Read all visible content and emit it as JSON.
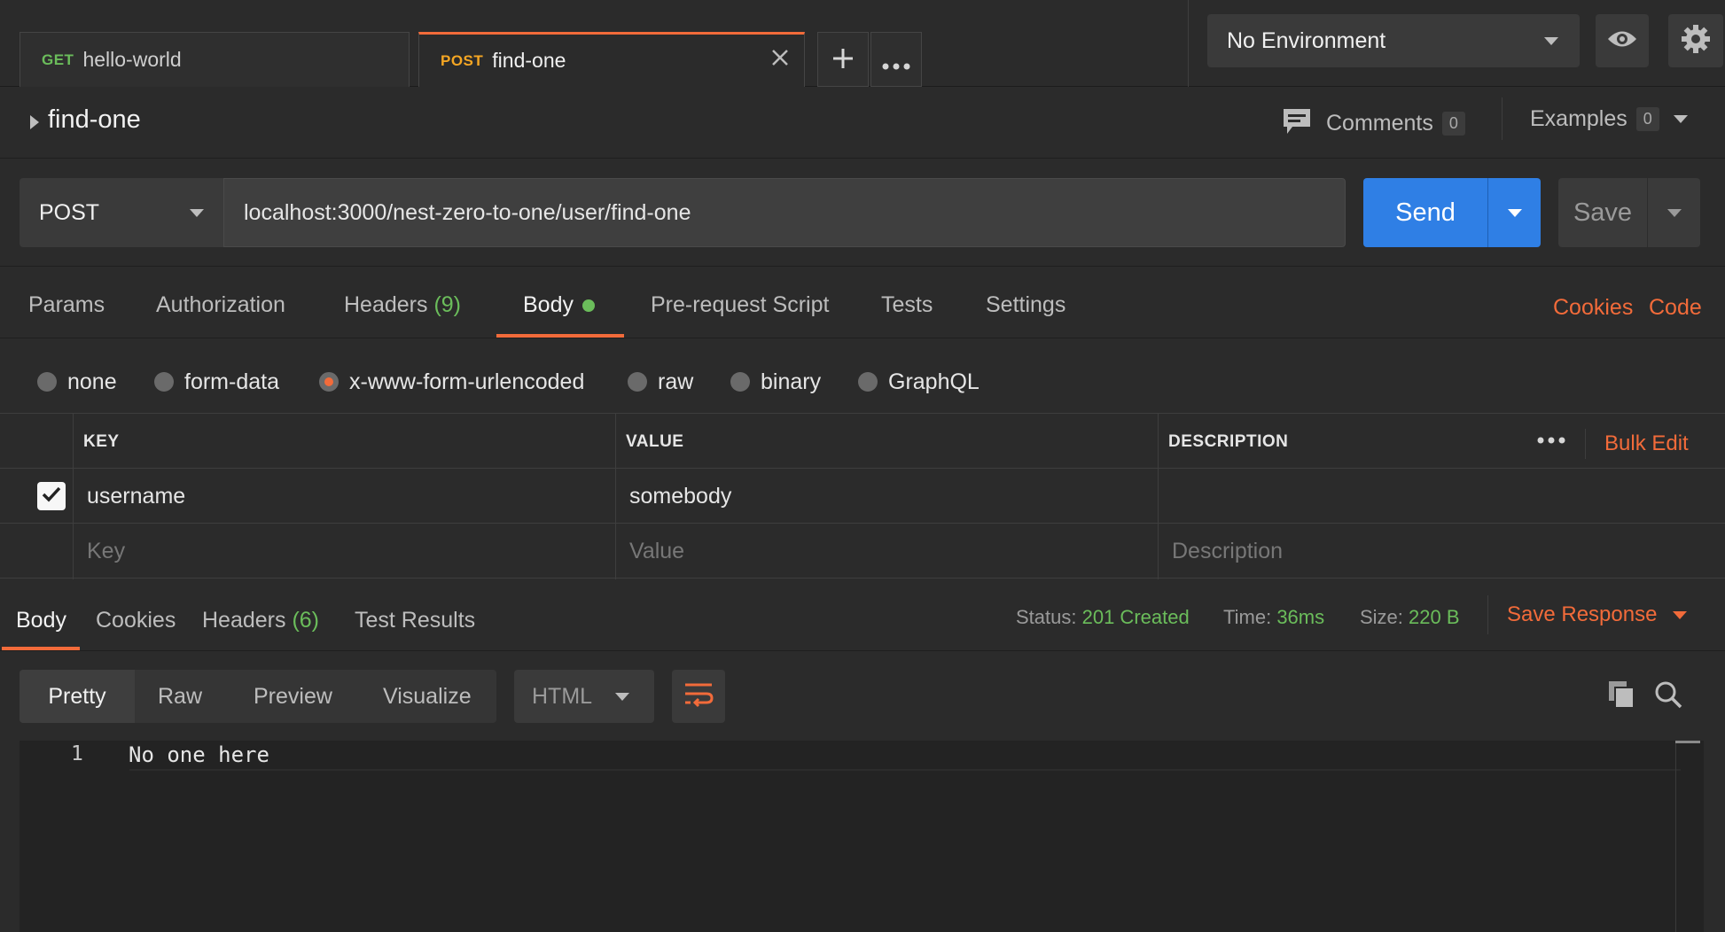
{
  "tabs": [
    {
      "method": "GET",
      "name": "hello-world"
    },
    {
      "method": "POST",
      "name": "find-one"
    }
  ],
  "tab_actions": {
    "add_icon": "plus-icon",
    "more_icon": "more-icon",
    "close_icon": "close-icon"
  },
  "environment": {
    "selected": "No Environment",
    "eye_icon": "eye-icon",
    "settings_icon": "gear-icon"
  },
  "request": {
    "title": "find-one",
    "comments_label": "Comments",
    "comments_count": "0",
    "examples_label": "Examples",
    "examples_count": "0",
    "method": "POST",
    "url": "localhost:3000/nest-zero-to-one/user/find-one",
    "send_label": "Send",
    "save_label": "Save"
  },
  "request_tabs": [
    {
      "label": "Params",
      "count": ""
    },
    {
      "label": "Authorization",
      "count": ""
    },
    {
      "label": "Headers",
      "count": "(9)"
    },
    {
      "label": "Body",
      "count": ""
    },
    {
      "label": "Pre-request Script",
      "count": ""
    },
    {
      "label": "Tests",
      "count": ""
    },
    {
      "label": "Settings",
      "count": ""
    }
  ],
  "request_links": {
    "cookies": "Cookies",
    "code": "Code"
  },
  "body_types": [
    "none",
    "form-data",
    "x-www-form-urlencoded",
    "raw",
    "binary",
    "GraphQL"
  ],
  "body_type_selected": "x-www-form-urlencoded",
  "table": {
    "headers": {
      "key": "KEY",
      "value": "VALUE",
      "description": "DESCRIPTION"
    },
    "bulk_edit": "Bulk Edit",
    "rows": [
      {
        "checked": true,
        "key": "username",
        "value": "somebody",
        "description": ""
      }
    ],
    "placeholders": {
      "key": "Key",
      "value": "Value",
      "description": "Description"
    }
  },
  "response_tabs": [
    {
      "label": "Body",
      "count": ""
    },
    {
      "label": "Cookies",
      "count": ""
    },
    {
      "label": "Headers",
      "count": "(6)"
    },
    {
      "label": "Test Results",
      "count": ""
    }
  ],
  "response_status": {
    "status_label": "Status:",
    "status_value": "201 Created",
    "time_label": "Time:",
    "time_value": "36ms",
    "size_label": "Size:",
    "size_value": "220 B",
    "save_response": "Save Response"
  },
  "response_view": {
    "modes": [
      "Pretty",
      "Raw",
      "Preview",
      "Visualize"
    ],
    "format": "HTML",
    "wrap_icon": "wrap-lines-icon",
    "copy_icon": "copy-icon",
    "search_icon": "search-icon"
  },
  "response_body": [
    {
      "line": "1",
      "text": "No one here"
    }
  ],
  "colors": {
    "accent": "#f26b3a",
    "send": "#2f7fe5",
    "success": "#6bbd5b",
    "post": "#f5a623"
  }
}
